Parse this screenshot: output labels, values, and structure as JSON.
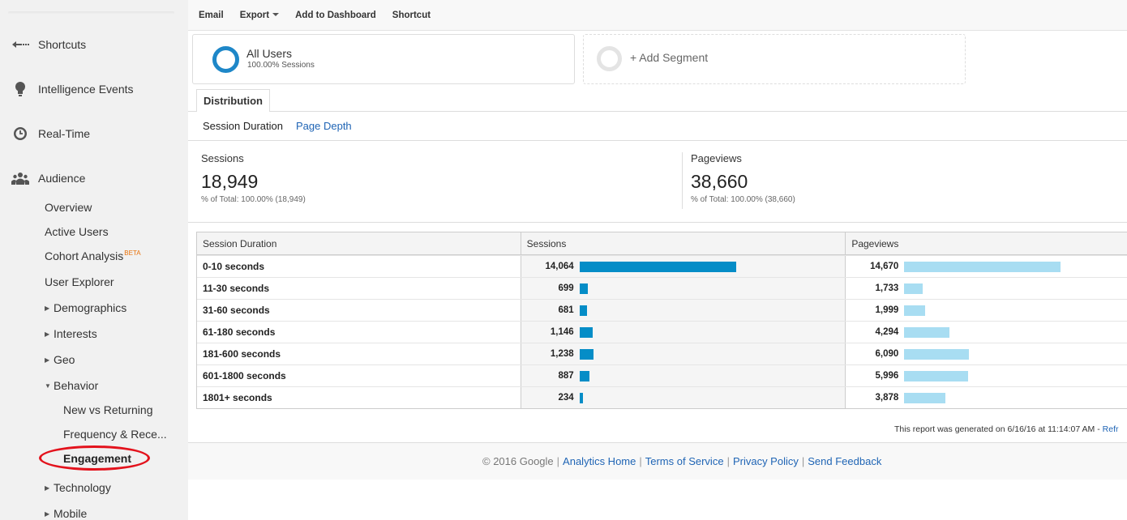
{
  "sidebar": {
    "main": [
      {
        "label": "Shortcuts",
        "icon": "arrow-left-icon"
      },
      {
        "label": "Intelligence Events",
        "icon": "lightbulb-icon"
      },
      {
        "label": "Real-Time",
        "icon": "clock-icon"
      },
      {
        "label": "Audience",
        "icon": "people-icon"
      }
    ],
    "audience_items": [
      {
        "label": "Overview"
      },
      {
        "label": "Active Users"
      },
      {
        "label": "Cohort Analysis",
        "badge": "BETA"
      },
      {
        "label": "User Explorer"
      },
      {
        "label": "Demographics"
      },
      {
        "label": "Interests"
      },
      {
        "label": "Geo"
      },
      {
        "label": "Behavior"
      }
    ],
    "behavior_items": [
      {
        "label": "New vs Returning"
      },
      {
        "label": "Frequency & Rece..."
      },
      {
        "label": "Engagement"
      }
    ],
    "more_items": [
      {
        "label": "Technology"
      },
      {
        "label": "Mobile"
      }
    ]
  },
  "toolbar": {
    "email": "Email",
    "export": "Export",
    "add_to_dashboard": "Add to Dashboard",
    "shortcut": "Shortcut"
  },
  "segments": {
    "all_users_title": "All Users",
    "all_users_sub": "100.00% Sessions",
    "add_segment": "+ Add Segment"
  },
  "tabs": {
    "distribution": "Distribution",
    "session_duration": "Session Duration",
    "page_depth": "Page Depth"
  },
  "metrics": {
    "sessions_label": "Sessions",
    "sessions_value": "18,949",
    "sessions_pct": "% of Total: 100.00% (18,949)",
    "pageviews_label": "Pageviews",
    "pageviews_value": "38,660",
    "pageviews_pct": "% of Total: 100.00% (38,660)"
  },
  "table": {
    "headers": [
      "Session Duration",
      "Sessions",
      "Pageviews"
    ],
    "rows": [
      {
        "duration": "0-10 seconds",
        "sessions": "14,064",
        "pageviews": "14,670"
      },
      {
        "duration": "11-30 seconds",
        "sessions": "699",
        "pageviews": "1,733"
      },
      {
        "duration": "31-60 seconds",
        "sessions": "681",
        "pageviews": "1,999"
      },
      {
        "duration": "61-180 seconds",
        "sessions": "1,146",
        "pageviews": "4,294"
      },
      {
        "duration": "181-600 seconds",
        "sessions": "1,238",
        "pageviews": "6,090"
      },
      {
        "duration": "601-1800 seconds",
        "sessions": "887",
        "pageviews": "5,996"
      },
      {
        "duration": "1801+ seconds",
        "sessions": "234",
        "pageviews": "3,878"
      }
    ]
  },
  "report": {
    "generated": "This report was generated on 6/16/16 at 11:14:07 AM - ",
    "refresh": "Refr"
  },
  "footer": {
    "copyright": "© 2016 Google",
    "links": [
      "Analytics Home",
      "Terms of Service",
      "Privacy Policy",
      "Send Feedback"
    ]
  },
  "colors": {
    "sessions_bar": "#058dc7",
    "pageviews_bar": "#a8ddf2",
    "link": "#2065b5",
    "highlight_circle": "#e3121c"
  }
}
